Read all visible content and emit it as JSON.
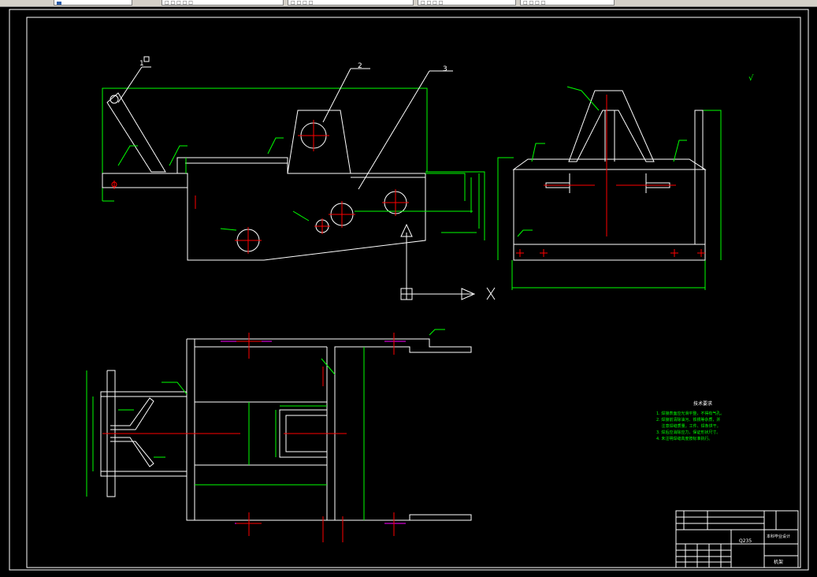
{
  "tabs": [
    {
      "label": "■",
      "icon": "drawing-icon"
    },
    {
      "label": "□ □ □ □ □"
    },
    {
      "label": "□ □ □ □"
    },
    {
      "label": "□ □ □ □"
    },
    {
      "label": "□ □ □ □"
    },
    {
      "label": "□ □ □ □ □"
    }
  ],
  "drawing": {
    "part_labels": [
      "1",
      "2",
      "3"
    ],
    "axis_label": "X",
    "roughness_symbol": "√",
    "notes_title": "技术要求",
    "notes": [
      "1. 焊接表面应光滑平整，不得有气孔。",
      "2. 焊接前清除油污、铁锈等杂质，并",
      "　 注意焊缝质量。工件、焊条烘干。",
      "3. 焊后应消除应力，保证形状尺寸。",
      "4. 未注明焊缝高度按标准执行。"
    ],
    "title_block": {
      "company": "本科毕业设计",
      "name": "机架",
      "material": "Q235"
    }
  },
  "colors": {
    "background": "#000000",
    "outline": "#ffffff",
    "dimension": "#00ff00",
    "center": "#ff0000",
    "hidden": "#ff00ff",
    "frame": "#ffffff"
  }
}
